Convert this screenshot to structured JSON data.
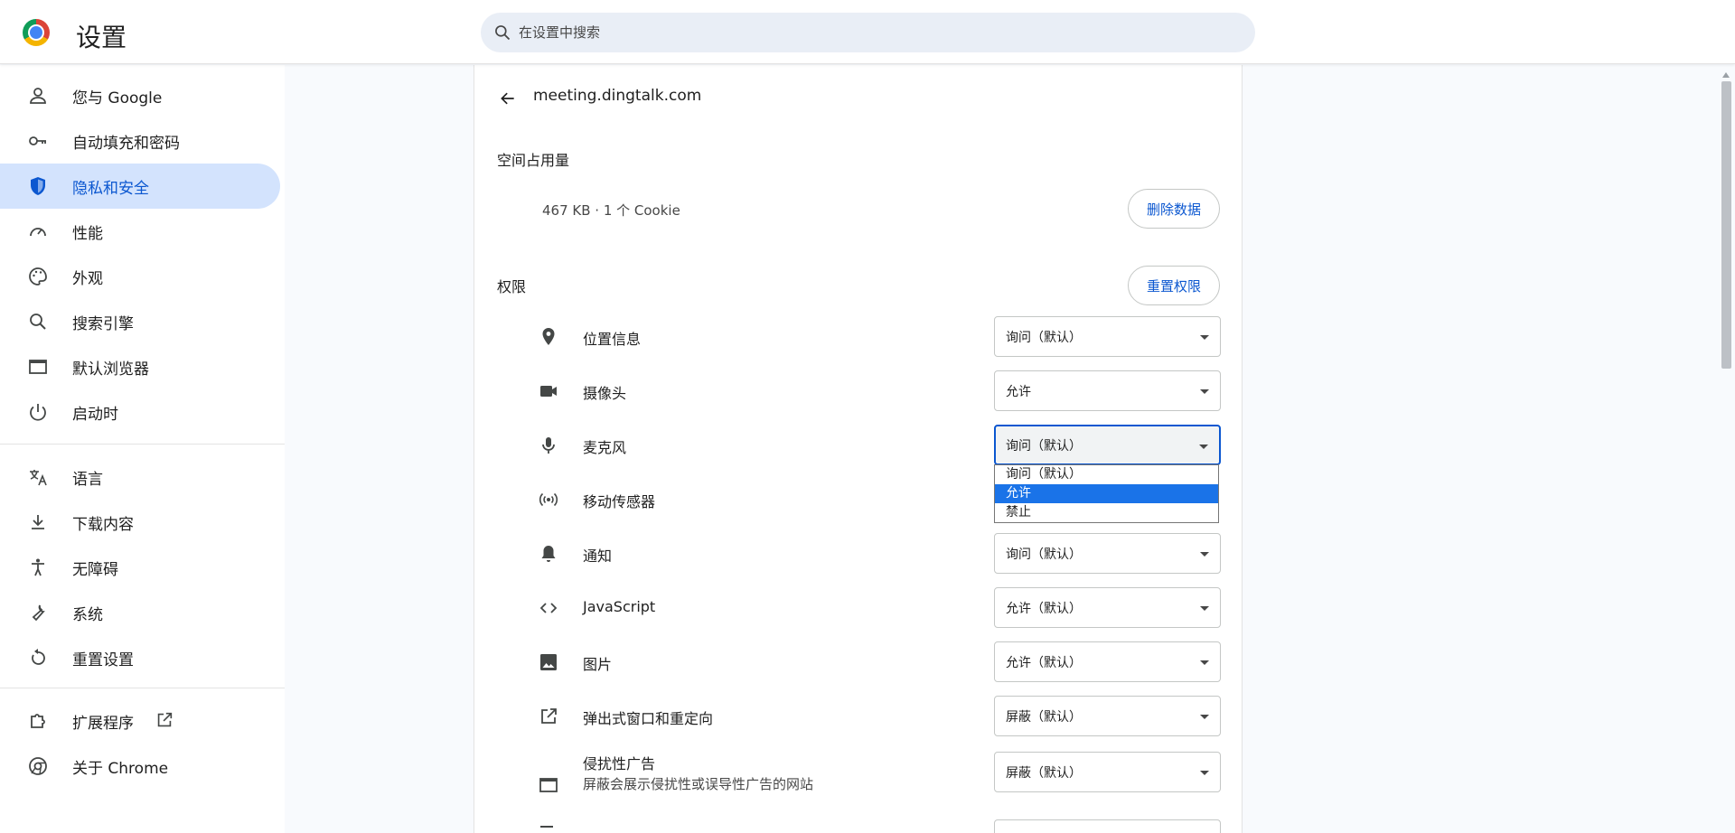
{
  "header": {
    "title": "设置",
    "search_placeholder": "在设置中搜索"
  },
  "sidebar": {
    "items": [
      {
        "label": "您与 Google",
        "icon": "person-icon"
      },
      {
        "label": "自动填充和密码",
        "icon": "key-icon"
      },
      {
        "label": "隐私和安全",
        "icon": "shield-icon",
        "active": true
      },
      {
        "label": "性能",
        "icon": "speedometer-icon"
      },
      {
        "label": "外观",
        "icon": "palette-icon"
      },
      {
        "label": "搜索引擎",
        "icon": "search-icon"
      },
      {
        "label": "默认浏览器",
        "icon": "browser-window-icon"
      },
      {
        "label": "启动时",
        "icon": "power-icon"
      },
      {
        "label": "语言",
        "icon": "translate-icon"
      },
      {
        "label": "下载内容",
        "icon": "download-icon"
      },
      {
        "label": "无障碍",
        "icon": "accessibility-icon"
      },
      {
        "label": "系统",
        "icon": "wrench-icon"
      },
      {
        "label": "重置设置",
        "icon": "reset-icon"
      },
      {
        "label": "扩展程序",
        "icon": "puzzle-icon"
      },
      {
        "label": "关于 Chrome",
        "icon": "chrome-icon"
      }
    ]
  },
  "site": {
    "name": "meeting.dingtalk.com"
  },
  "usage": {
    "section_title": "空间占用量",
    "summary": "467 KB · 1 个 Cookie",
    "delete_label": "删除数据"
  },
  "permissions": {
    "section_title": "权限",
    "reset_label": "重置权限",
    "rows": [
      {
        "label": "位置信息",
        "value": "询问（默认）",
        "icon": "location-pin-icon"
      },
      {
        "label": "摄像头",
        "value": "允许",
        "icon": "camera-icon"
      },
      {
        "label": "麦克风",
        "value": "询问（默认）",
        "icon": "microphone-icon",
        "focused": true
      },
      {
        "label": "移动传感器",
        "value": "",
        "icon": "sensors-icon"
      },
      {
        "label": "通知",
        "value": "询问（默认）",
        "icon": "bell-icon"
      },
      {
        "label": "JavaScript",
        "value": "允许（默认）",
        "icon": "code-icon"
      },
      {
        "label": "图片",
        "value": "允许（默认）",
        "icon": "image-icon"
      },
      {
        "label": "弹出式窗口和重定向",
        "value": "屏蔽（默认）",
        "icon": "open-in-new-icon"
      },
      {
        "label": "侵扰性广告",
        "sub": "屏蔽会展示侵扰性或误导性广告的网站",
        "value": "屏蔽（默认）",
        "icon": "ad-window-icon"
      }
    ]
  },
  "dropdown": {
    "options": [
      "询问（默认）",
      "允许",
      "禁止"
    ],
    "highlighted_index": 1
  },
  "colors": {
    "accent": "#0b57d0",
    "active_nav_bg": "#d3e3fd",
    "dropdown_highlight": "#1a73e8"
  }
}
